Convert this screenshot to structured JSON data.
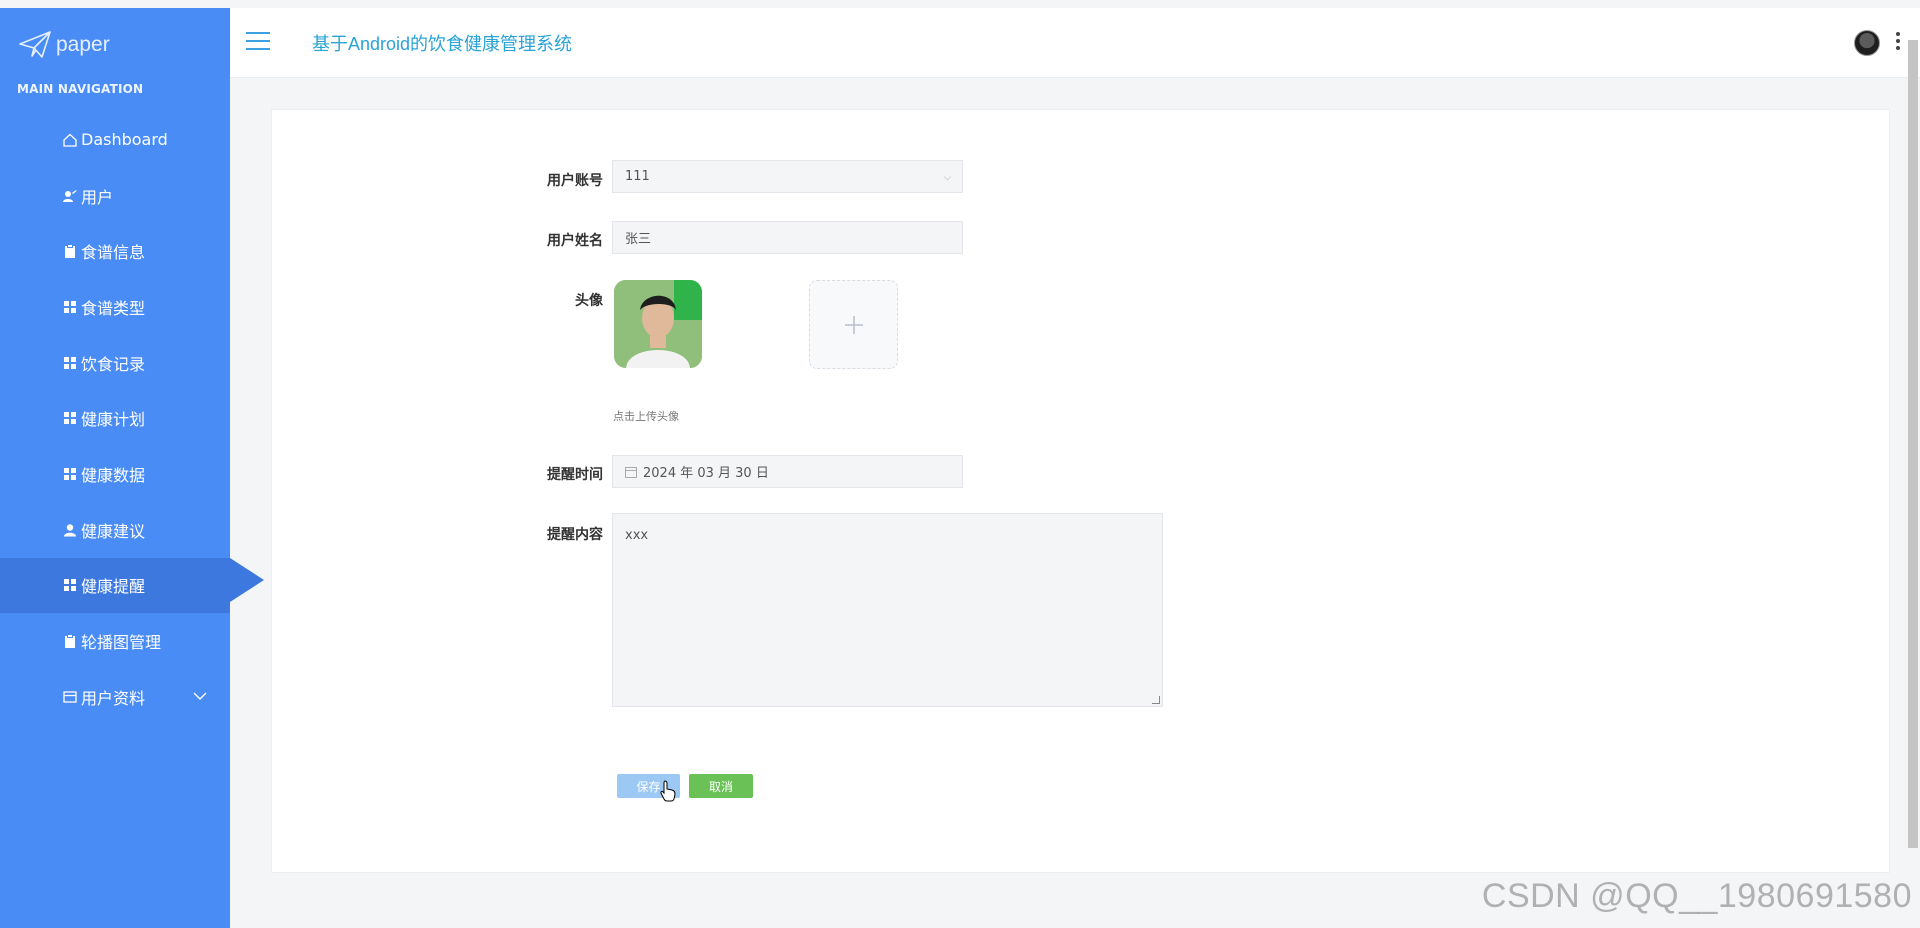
{
  "brand": {
    "name": "paper"
  },
  "sidebar": {
    "heading": "MAIN NAVIGATION",
    "items": [
      {
        "label": "Dashboard",
        "icon": "home-icon"
      },
      {
        "label": "用户",
        "icon": "user-edit-icon"
      },
      {
        "label": "食谱信息",
        "icon": "clipboard-icon"
      },
      {
        "label": "食谱类型",
        "icon": "grid-icon"
      },
      {
        "label": "饮食记录",
        "icon": "grid-icon"
      },
      {
        "label": "健康计划",
        "icon": "grid-icon"
      },
      {
        "label": "健康数据",
        "icon": "grid-icon"
      },
      {
        "label": "健康建议",
        "icon": "person-icon"
      },
      {
        "label": "健康提醒",
        "icon": "grid-icon",
        "active": true
      },
      {
        "label": "轮播图管理",
        "icon": "clipboard-icon"
      },
      {
        "label": "用户资料",
        "icon": "card-icon",
        "expandable": true
      }
    ]
  },
  "header": {
    "title": "基于Android的饮食健康管理系统"
  },
  "form": {
    "account_label": "用户账号",
    "account_value": "111",
    "name_label": "用户姓名",
    "name_value": "张三",
    "avatar_label": "头像",
    "upload_hint": "点击上传头像",
    "time_label": "提醒时间",
    "time_value": "2024 年 03 月 30 日",
    "content_label": "提醒内容",
    "content_value": "xxx",
    "save_label": "保存",
    "cancel_label": "取消"
  },
  "watermark": "CSDN @QQ__1980691580",
  "colors": {
    "sidebar": "#4a8cf6",
    "sidebar_active": "#3d78df",
    "title": "#2aa3d6",
    "save": "#9cc9f3",
    "cancel": "#6ac257"
  }
}
